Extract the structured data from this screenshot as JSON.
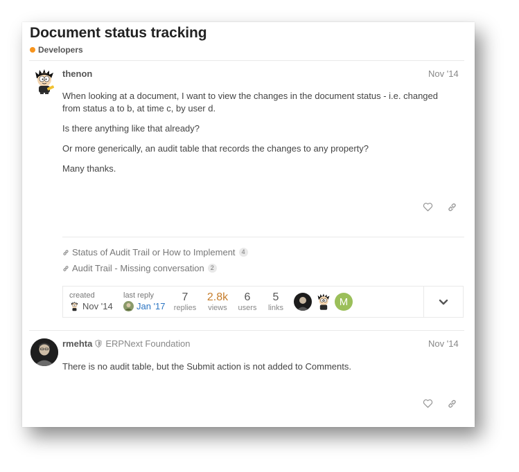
{
  "topic": {
    "title": "Document status tracking",
    "category": "Developers",
    "category_color": "#f7941d"
  },
  "post1": {
    "username": "thenon",
    "date": "Nov '14",
    "paragraphs": [
      "When looking at a document, I want to view the changes in the document status - i.e. changed from status a to b, at time c, by user d.",
      "Is there anything like that already?",
      "Or more generically, an audit table that records the changes to any property?",
      "Many thanks."
    ],
    "actions": [
      "like-icon",
      "link-icon"
    ]
  },
  "links": [
    {
      "title": "Status of Audit Trail or How to Implement",
      "count": "4"
    },
    {
      "title": "Audit Trail - Missing conversation",
      "count": "2"
    }
  ],
  "topic_map": {
    "created_label": "created",
    "created_date": "Nov '14",
    "last_reply_label": "last reply",
    "last_reply_date": "Jan '17",
    "replies_count": "7",
    "replies_label": "replies",
    "views_count": "2.8k",
    "views_label": "views",
    "users_count": "6",
    "users_label": "users",
    "links_count": "5",
    "links_label": "links",
    "participant_m_letter": "M",
    "views_color": "#c67d2b",
    "last_reply_color": "#2a74c2"
  },
  "post2": {
    "username": "rmehta",
    "title": "ERPNext Foundation",
    "date": "Nov '14",
    "paragraphs": [
      "There is no audit table, but the Submit action is not added to Comments."
    ],
    "actions": [
      "like-icon",
      "link-icon"
    ]
  }
}
